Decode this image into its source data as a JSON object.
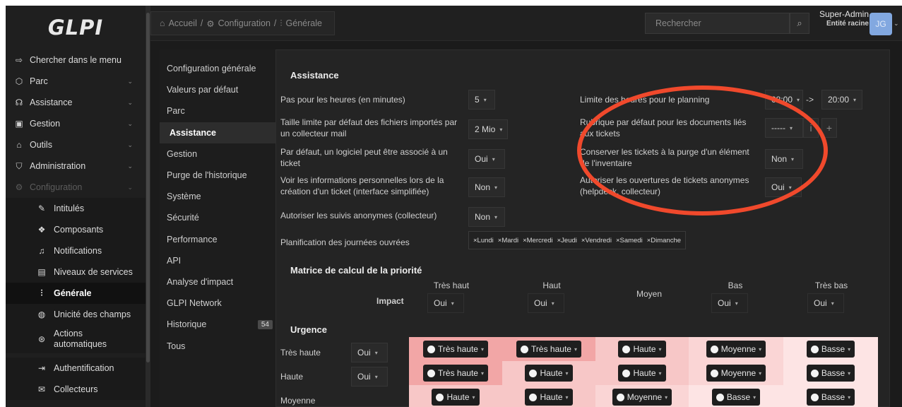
{
  "app": {
    "logo": "GLPI"
  },
  "sidebar": {
    "items": [
      {
        "icon": "menu-search-icon",
        "glyph": "⇨",
        "label": "Chercher dans le menu"
      },
      {
        "icon": "cube-icon",
        "glyph": "⬡",
        "label": "Parc"
      },
      {
        "icon": "headset-icon",
        "glyph": "☊",
        "label": "Assistance"
      },
      {
        "icon": "wallet-icon",
        "glyph": "▣",
        "label": "Gestion"
      },
      {
        "icon": "briefcase-icon",
        "glyph": "⌂",
        "label": "Outils"
      },
      {
        "icon": "shield-icon",
        "glyph": "⛉",
        "label": "Administration"
      },
      {
        "icon": "settings-icon",
        "glyph": "⚙",
        "label": "Configuration"
      }
    ],
    "subitems": [
      {
        "icon": "pencil-icon",
        "glyph": "✎",
        "label": "Intitulés"
      },
      {
        "icon": "components-icon",
        "glyph": "❖",
        "label": "Composants"
      },
      {
        "icon": "bell-icon",
        "glyph": "♫",
        "label": "Notifications"
      },
      {
        "icon": "checklist-icon",
        "glyph": "▤",
        "label": "Niveaux de services"
      },
      {
        "icon": "sliders-icon",
        "glyph": "⫶",
        "label": "Générale"
      },
      {
        "icon": "fingerprint-icon",
        "glyph": "◍",
        "label": "Unicité des champs"
      },
      {
        "icon": "automation-icon",
        "glyph": "⊛",
        "label": "Actions automatiques"
      },
      {
        "icon": "login-icon",
        "glyph": "⇥",
        "label": "Authentification"
      },
      {
        "icon": "inbox-icon",
        "glyph": "✉",
        "label": "Collecteurs"
      }
    ]
  },
  "header": {
    "breadcrumb": {
      "home": "Accueil",
      "config": "Configuration",
      "page": "Générale",
      "sep": "/"
    },
    "search_placeholder": "Rechercher",
    "user_name": "Super-Admin",
    "user_entity": "Entité racine",
    "avatar_initials": "JG"
  },
  "tabs": [
    {
      "label": "Configuration générale"
    },
    {
      "label": "Valeurs par défaut"
    },
    {
      "label": "Parc"
    },
    {
      "label": "Assistance"
    },
    {
      "label": "Gestion"
    },
    {
      "label": "Purge de l'historique"
    },
    {
      "label": "Système"
    },
    {
      "label": "Sécurité"
    },
    {
      "label": "Performance"
    },
    {
      "label": "API"
    },
    {
      "label": "Analyse d'impact"
    },
    {
      "label": "GLPI Network"
    },
    {
      "label": "Historique",
      "badge": "54"
    },
    {
      "label": "Tous"
    }
  ],
  "assistance": {
    "title": "Assistance",
    "hours_step": {
      "label": "Pas pour les heures (en minutes)",
      "value": "5"
    },
    "file_limit": {
      "label": "Taille limite par défaut des fichiers importés par un collecteur mail",
      "value": "2 Mio"
    },
    "software_ticket": {
      "label": "Par défaut, un logiciel peut être associé à un ticket",
      "value": "Oui"
    },
    "personal_info": {
      "label": "Voir les informations personnelles lors de la création d'un ticket (interface simplifiée)",
      "value": "Non"
    },
    "anon_followups": {
      "label": "Autoriser les suivis anonymes (collecteur)",
      "value": "Non"
    },
    "workdays": {
      "label": "Planification des journées ouvrées",
      "days": [
        "×Lundi",
        "×Mardi",
        "×Mercredi",
        "×Jeudi",
        "×Vendredi",
        "×Samedi",
        "×Dimanche"
      ]
    },
    "planning_limit": {
      "label": "Limite des heures pour le planning",
      "from": "08:00",
      "arrow": "->",
      "to": "20:00"
    },
    "doc_category": {
      "label": "Rubrique par défaut pour les documents liés aux tickets",
      "value": "-----",
      "plus": "+"
    },
    "keep_tickets": {
      "label": "Conserver les tickets à la purge d'un élément de l'inventaire",
      "value": "Non"
    },
    "anon_tickets": {
      "label": "Autoriser les ouvertures de tickets anonymes (helpdesk, collecteur)",
      "value": "Oui"
    }
  },
  "matrix": {
    "title": "Matrice de calcul de la priorité",
    "impact_label": "Impact",
    "urgence_label": "Urgence",
    "columns": [
      {
        "label": "Très haut",
        "value": "Oui"
      },
      {
        "label": "Haut",
        "value": "Oui"
      },
      {
        "label": "Moyen",
        "value": ""
      },
      {
        "label": "Bas",
        "value": "Oui"
      },
      {
        "label": "Très bas",
        "value": "Oui"
      }
    ],
    "rows": [
      {
        "label": "Très haute",
        "value": "Oui",
        "cells": [
          "Très haute",
          "Très haute",
          "Haute",
          "Moyenne",
          "Basse"
        ]
      },
      {
        "label": "Haute",
        "value": "Oui",
        "cells": [
          "Très haute",
          "Haute",
          "Haute",
          "Moyenne",
          "Basse"
        ]
      },
      {
        "label": "Moyenne",
        "value": "",
        "cells": [
          "Haute",
          "Haute",
          "Moyenne",
          "Basse",
          "Basse"
        ]
      }
    ],
    "priority_colors": {
      "Très haute": "#f2a0a0",
      "Haute": "#f6c4c4",
      "Moyenne": "#fbdada",
      "Basse": "#fde8e8"
    },
    "cell_bg": {
      "Très haute": "#f2a6a6",
      "Haute": "#f7c7c7",
      "Moyenne": "#fad5d5",
      "Basse": "#fde4e4"
    }
  },
  "annotation_color": "#f0492c"
}
